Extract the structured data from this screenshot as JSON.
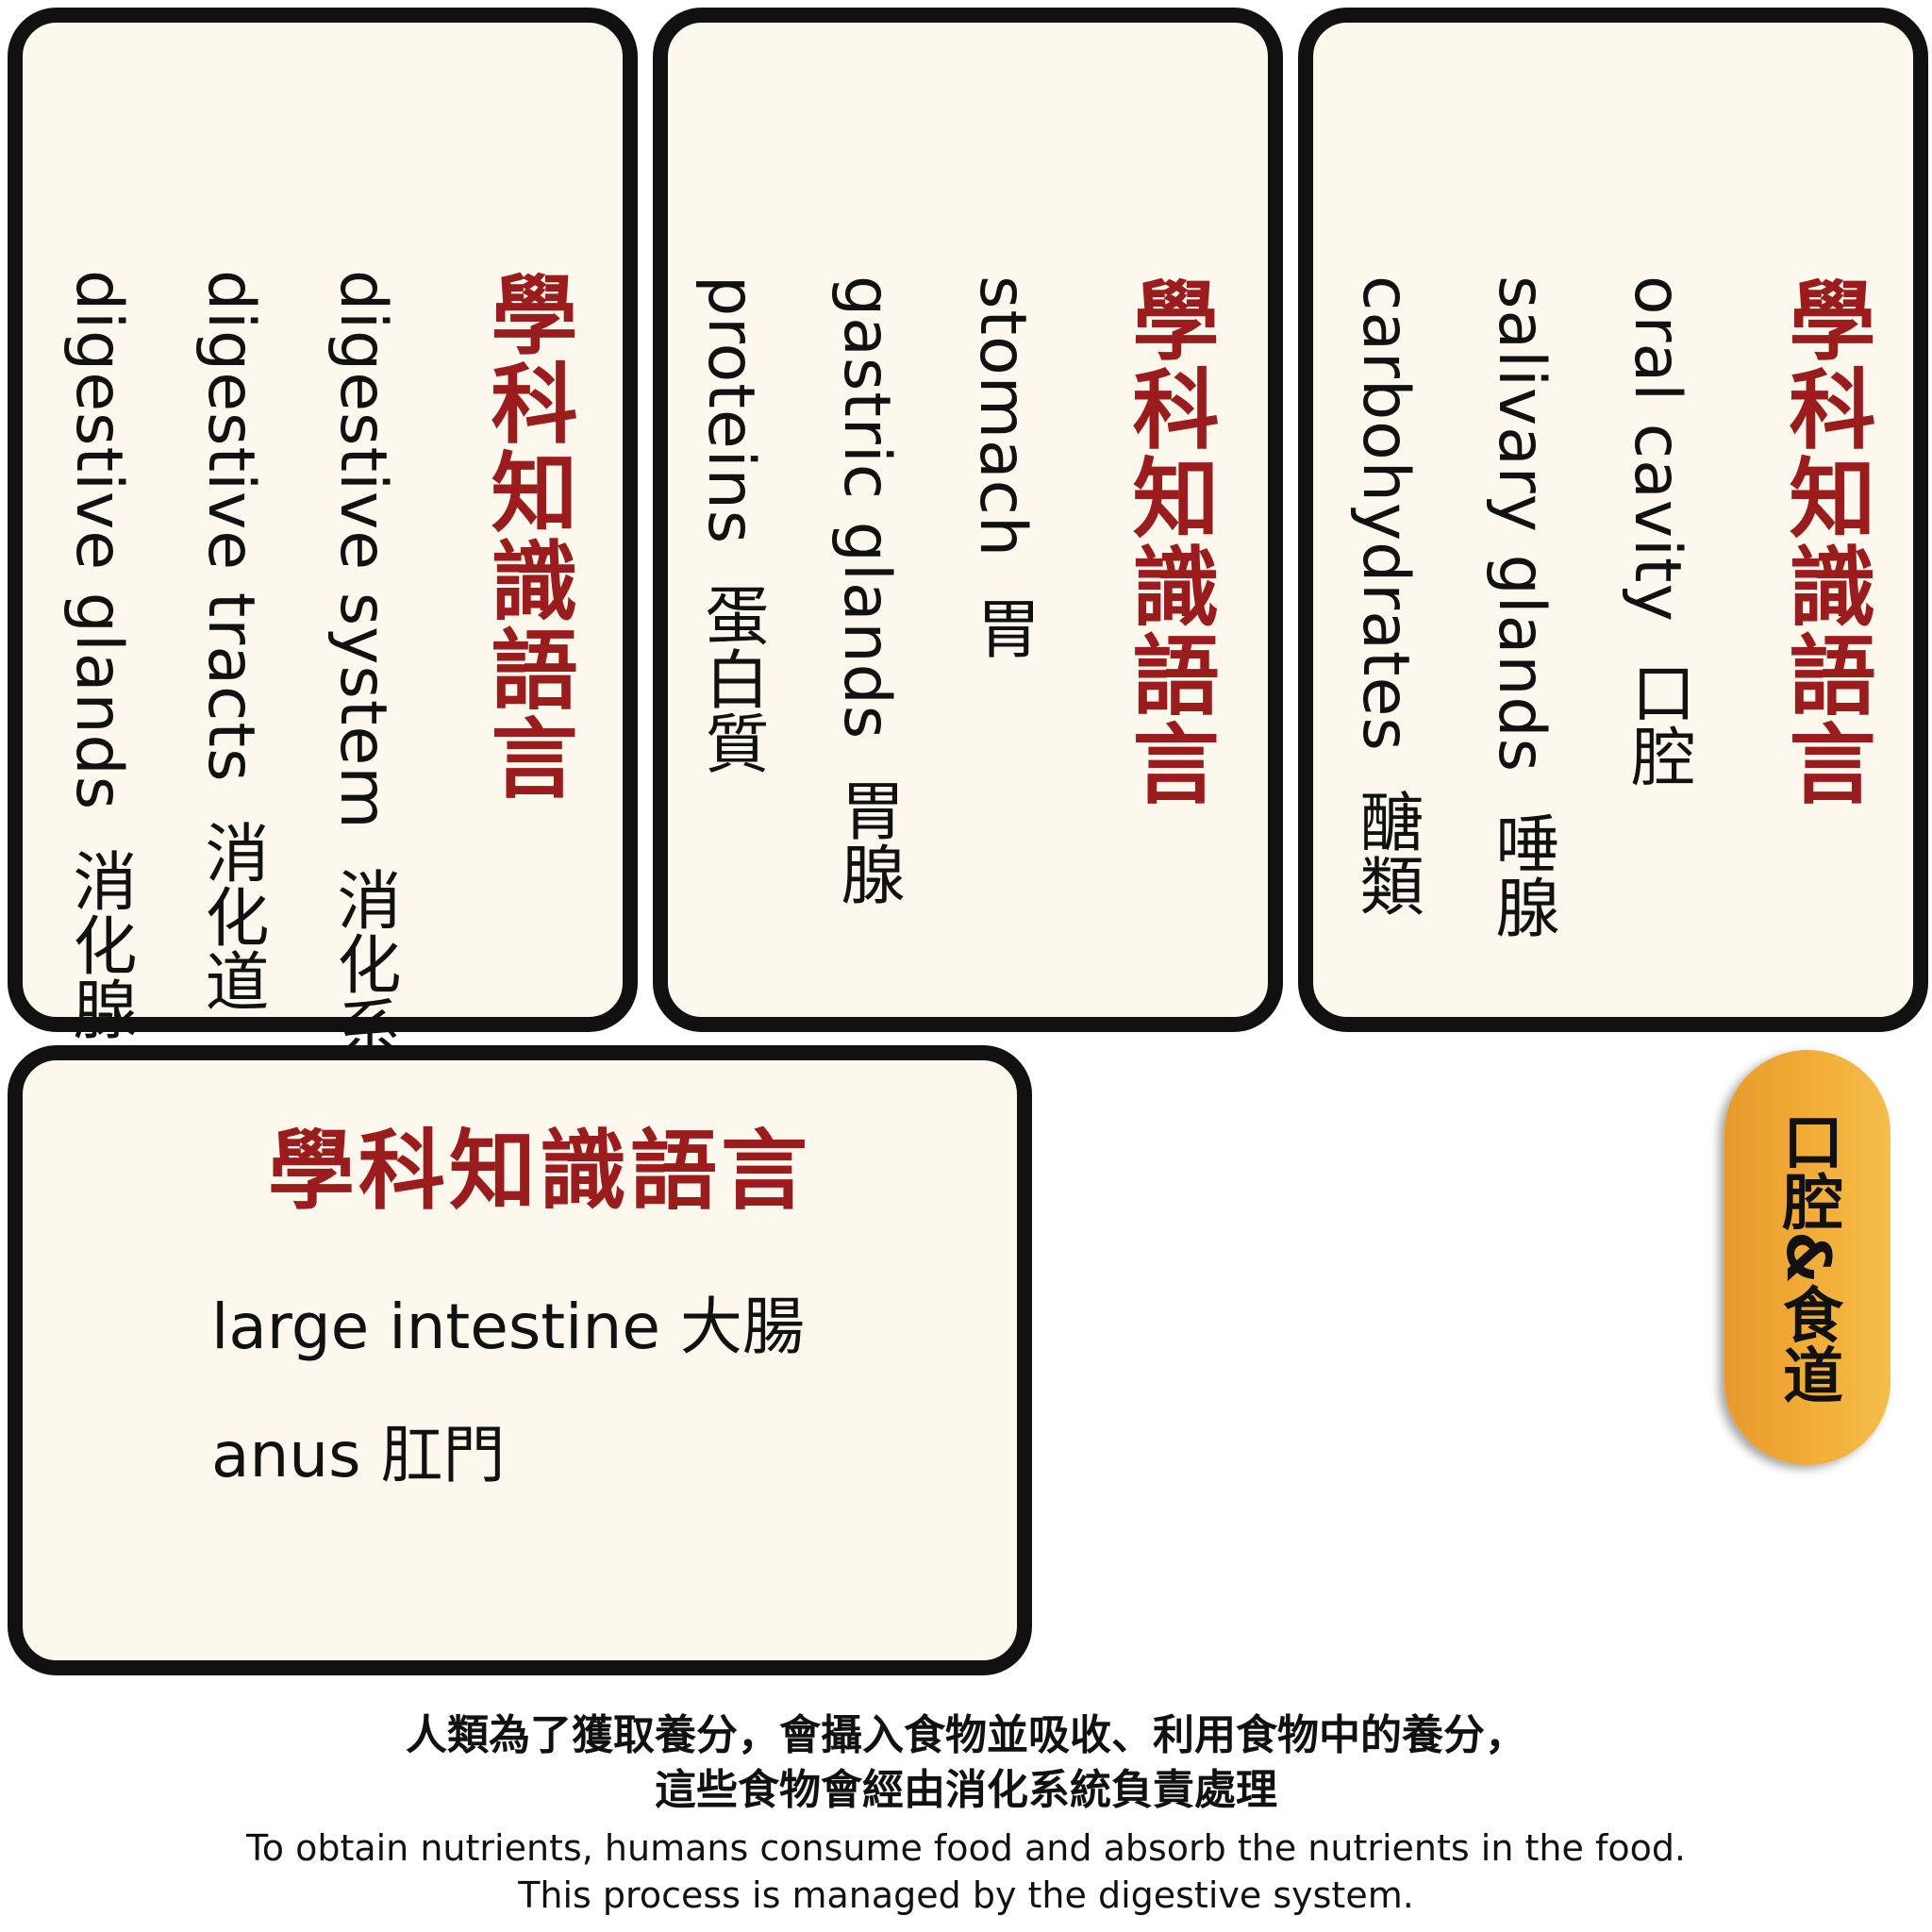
{
  "cards": [
    {
      "title": "學科知識語言",
      "terms": [
        {
          "en": "oral cavity",
          "zh": "口腔"
        },
        {
          "en": "salivary glands",
          "zh": "唾腺"
        },
        {
          "en": "carbohydrates",
          "zh": "醣類"
        }
      ]
    },
    {
      "title": "學科知識語言",
      "terms": [
        {
          "en": "stomach",
          "zh": "胃"
        },
        {
          "en": "gastric glands",
          "zh": "胃腺"
        },
        {
          "en": "proteins",
          "zh": "蛋白質"
        }
      ]
    },
    {
      "title": "學科知識語言",
      "terms": [
        {
          "en": "digestive system",
          "zh": "消化系統"
        },
        {
          "en": "digestive tracts",
          "zh": "消化道"
        },
        {
          "en": "digestive glands",
          "zh": "消化腺"
        }
      ]
    },
    {
      "title": "學科知識語言",
      "terms": [
        {
          "en": "large intestine",
          "zh": "大腸"
        },
        {
          "en": "anus",
          "zh": "肛門"
        }
      ]
    }
  ],
  "tab": {
    "label": "口腔&食道"
  },
  "caption": {
    "zh_line1": "人類為了獲取養分，會攝入食物並吸收、利用食物中的養分，",
    "zh_line2": "這些食物會經由消化系統負責處理",
    "en_line1": "To obtain nutrients, humans consume food and absorb the nutrients in the food.",
    "en_line2": "This process is managed by the digestive system."
  },
  "colors": {
    "title": "#9a1c1c",
    "card_bg": "#fcf8ee",
    "border": "#111111",
    "tab": "#f2ad38"
  }
}
